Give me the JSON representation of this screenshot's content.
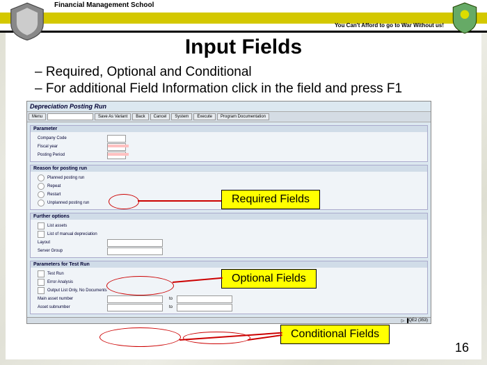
{
  "header": {
    "school": "Financial Management School",
    "tagline": "You Can't Afford to go to War Without us!"
  },
  "title": "Input Fields",
  "bullets": [
    "Required, Optional and Conditional",
    "For additional Field Information click in the field and press F1"
  ],
  "app": {
    "title": "Depreciation Posting Run",
    "toolbar": {
      "menu": "Menu",
      "save": "Save As Variant",
      "back": "Back",
      "cancel": "Cancel",
      "system": "System",
      "execute": "Execute",
      "docs": "Program Documentation"
    },
    "panel1": {
      "title": "Parameter",
      "company": "Company Code",
      "fiscal": "Fiscal year",
      "period": "Posting Period"
    },
    "panel2": {
      "title": "Reason for posting run",
      "opt1": "Planned posting run",
      "opt2": "Repeat",
      "opt3": "Restart",
      "opt4": "Unplanned posting run"
    },
    "panel3": {
      "title": "Further options",
      "opt1": "List assets",
      "opt2": "List of manual depreciation",
      "layout": "Layout",
      "server": "Server Group"
    },
    "panel4": {
      "title": "Parameters for Test Run",
      "opt1": "Test Run",
      "opt2": "Error Analysis",
      "opt3": "Output List Only, No Documents",
      "main": "Main asset number",
      "sub": "Asset subnumber",
      "to": "to"
    },
    "status": "QE2 (353)"
  },
  "callouts": {
    "req": "Required Fields",
    "opt": "Optional Fields",
    "cond": "Conditional Fields"
  },
  "page": "16"
}
